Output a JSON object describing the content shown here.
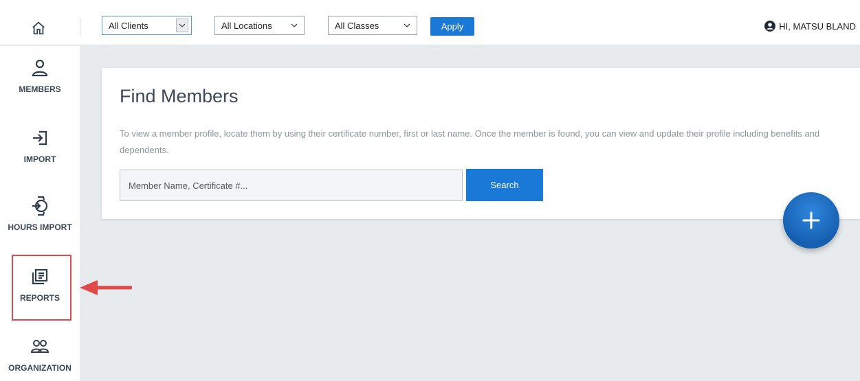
{
  "header": {
    "home_icon": "home-icon",
    "filters": {
      "clients": "All Clients",
      "locations": "All Locations",
      "classes": "All Classes"
    },
    "apply_label": "Apply",
    "user_label": "HI, MATSU BLAND",
    "user_icon": "user-circle-icon"
  },
  "sidebar": {
    "items": [
      {
        "label": "MEMBERS",
        "icon": "person-icon"
      },
      {
        "label": "IMPORT",
        "icon": "import-icon"
      },
      {
        "label": "HOURS IMPORT",
        "icon": "hours-import-icon"
      },
      {
        "label": "REPORTS",
        "icon": "reports-icon",
        "highlighted": true
      },
      {
        "label": "ORGANIZATION",
        "icon": "organization-icon"
      }
    ]
  },
  "main": {
    "title": "Find Members",
    "description": "To view a member profile, locate them by using their certificate number, first or last name. Once the member is found, you can view and update their profile including benefits and dependents.",
    "search_placeholder": "Member Name, Certificate #...",
    "search_label": "Search"
  },
  "fab": {
    "icon": "plus-icon"
  },
  "colors": {
    "accent": "#1a78d6",
    "highlight": "#e04a4a",
    "background": "#e8ebee"
  }
}
